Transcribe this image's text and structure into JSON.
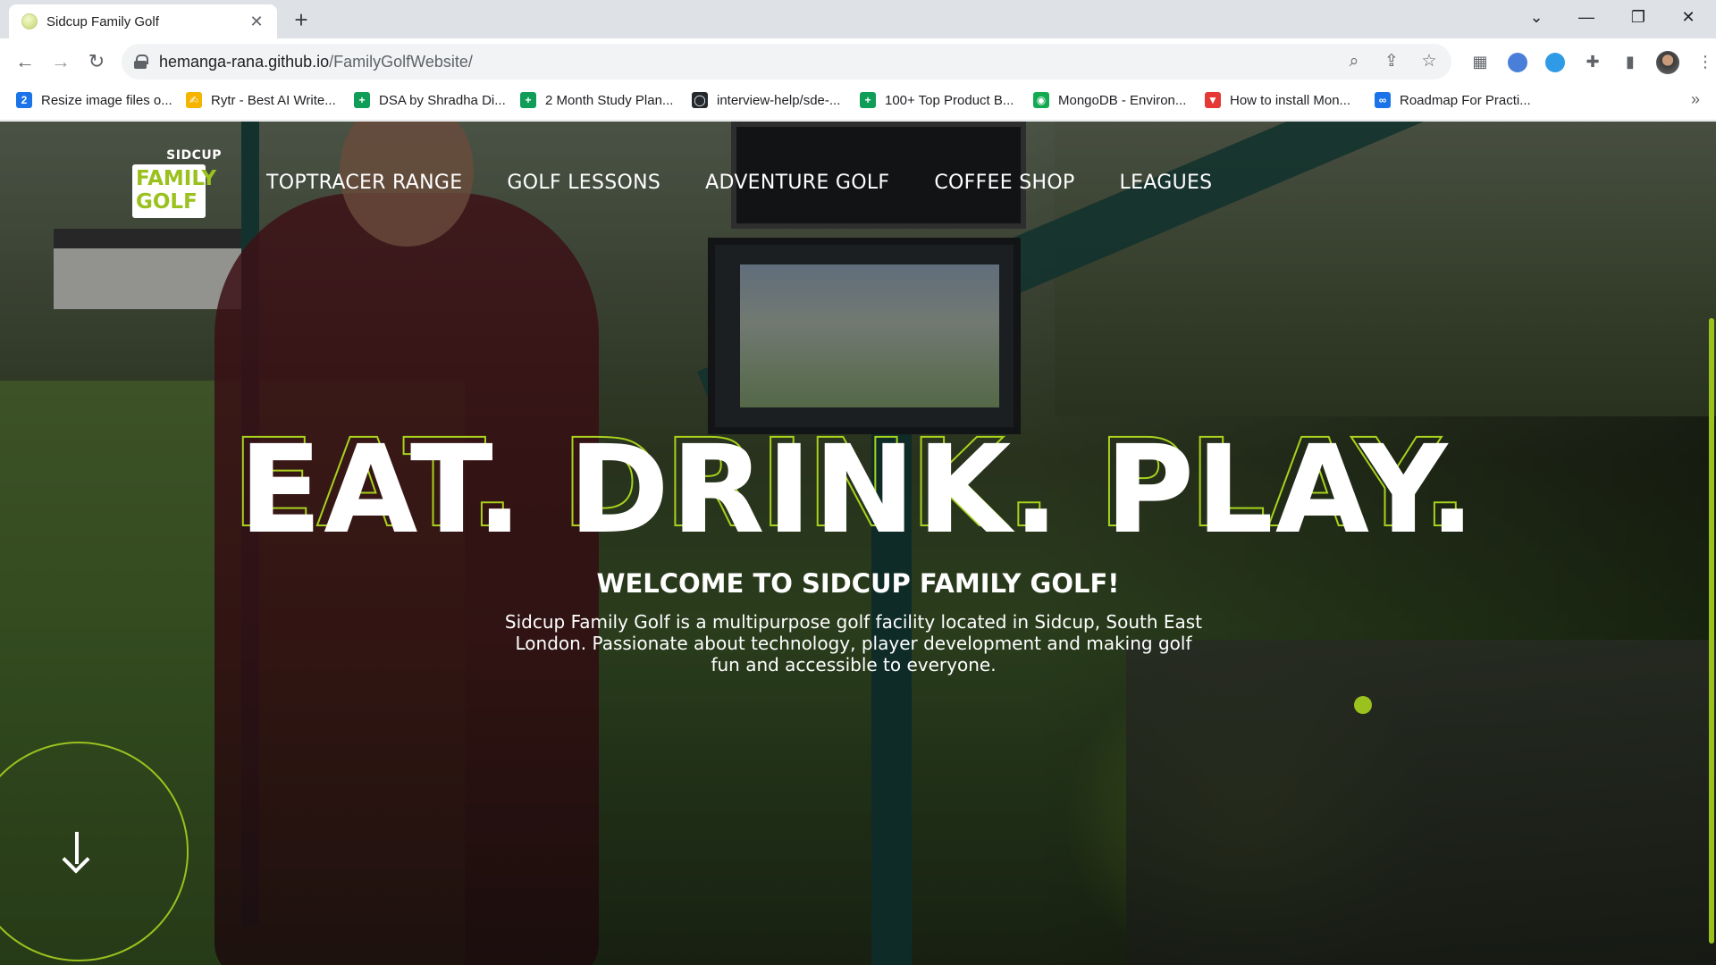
{
  "browser": {
    "tab_title": "Sidcup Family Golf",
    "tab_close": "✕",
    "new_tab": "+",
    "url_host": "hemanga-rana.github.io",
    "url_path": "/FamilyGolfWebsite/",
    "window_controls": {
      "dropdown": "⌄",
      "minimize": "—",
      "restore": "❐",
      "close": "✕"
    }
  },
  "bookmarks": [
    {
      "label": "Resize image files o...",
      "icon": "resize-icon",
      "color": "#1a73e8",
      "glyph": "2"
    },
    {
      "label": "Rytr - Best AI Write...",
      "icon": "rytr-icon",
      "color": "#f4b400",
      "glyph": "✍"
    },
    {
      "label": "DSA by Shradha Di...",
      "icon": "sheets-icon",
      "color": "#0f9d58",
      "glyph": "+"
    },
    {
      "label": "2 Month Study Plan...",
      "icon": "sheets-icon",
      "color": "#0f9d58",
      "glyph": "+"
    },
    {
      "label": "interview-help/sde-...",
      "icon": "github-icon",
      "color": "#24292e",
      "glyph": "◯"
    },
    {
      "label": "100+ Top Product B...",
      "icon": "sheets-icon",
      "color": "#0f9d58",
      "glyph": "+"
    },
    {
      "label": "MongoDB - Environ...",
      "icon": "mongodb-icon",
      "color": "#13aa52",
      "glyph": "◉"
    },
    {
      "label": "How to install Mon...",
      "icon": "vivaldi-icon",
      "color": "#e53935",
      "glyph": "▼"
    },
    {
      "label": "Roadmap For Practi...",
      "icon": "infinity-icon",
      "color": "#1a73e8",
      "glyph": "∞"
    }
  ],
  "bookmarks_more": "»",
  "site": {
    "logo": {
      "top": "SIDCUP",
      "line1": "FAMILY",
      "line2": "GOLF"
    },
    "nav": [
      "TOPTRACER RANGE",
      "GOLF LESSONS",
      "ADVENTURE GOLF",
      "COFFEE SHOP",
      "LEAGUES"
    ],
    "hero_title": "EAT. DRINK. PLAY.",
    "welcome": "WELCOME TO SIDCUP FAMILY GOLF!",
    "intro": "Sidcup Family Golf is a multipurpose golf facility located in Sidcup, South East London. Passionate about technology, player development and making golf fun and accessible to everyone."
  },
  "colors": {
    "accent": "#9bc11f",
    "text": "#ffffff"
  }
}
